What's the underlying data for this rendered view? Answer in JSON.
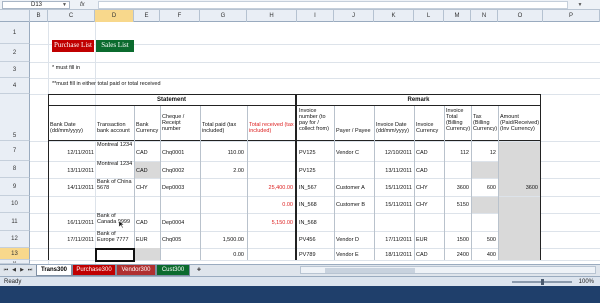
{
  "formula_bar": {
    "name_box": "D13",
    "fx_symbol": "fx",
    "formula": ""
  },
  "columns": [
    "B",
    "C",
    "D",
    "E",
    "F",
    "G",
    "H",
    "I",
    "J",
    "K",
    "L",
    "M",
    "N",
    "O",
    "P"
  ],
  "rows": [
    "1",
    "2",
    "3",
    "4",
    "5",
    "7",
    "8",
    "9",
    "10",
    "11",
    "12",
    "13",
    "14"
  ],
  "buttons": {
    "purchase": "Purchase List",
    "sales": "Sales List"
  },
  "notes": {
    "note1": "* must fill in",
    "note2": "**must fill in either total paid or total received"
  },
  "sections": {
    "statement": "Statement",
    "remark": "Remark"
  },
  "headers": {
    "bank_date": "Bank Date (dd/mm/yyyy)",
    "transaction_bank_account": "Transaction bank account",
    "bank_currency": "Bank Currency",
    "cheque_number": "Cheque / Receipt number",
    "total_paid": "Total paid (tax included)",
    "total_received": "Total received (tax included)",
    "invoice_number": "Invoice number (to pay for / collect from)",
    "payer_payee": "Payer / Payee",
    "invoice_date": "Invoice Date (dd/mm/yyyy)",
    "invoice_currency": "Invoice Currency",
    "invoice_total": "Invoice Total (Billing Currency)",
    "tax": "Tax (Billing Currency)",
    "amount": "Amount (Paid/Received) (Inv Currency)"
  },
  "data_rows": [
    {
      "date": "12/11/2011",
      "account": "Montreal 1234",
      "currency": "CAD",
      "cheque": "Chq0001",
      "paid": "110.00",
      "received": "",
      "invoice": "PV125",
      "payer": "Vendor C",
      "inv_date": "12/10/2011",
      "inv_cur": "CAD",
      "inv_total": "112",
      "tax": "12",
      "amount": ""
    },
    {
      "date": "13/11/2011",
      "account": "Montreal 1234",
      "currency": "CAD",
      "cheque": "Chq0002",
      "paid": "2.00",
      "received": "",
      "invoice": "PV125",
      "payer": "",
      "inv_date": "13/11/2011",
      "inv_cur": "CAD",
      "inv_total": "",
      "tax": "",
      "amount": ""
    },
    {
      "date": "14/11/2011",
      "account": "Bank of China 5678",
      "currency": "CHY",
      "cheque": "Dep0003",
      "paid": "",
      "received": "25,400.00",
      "invoice": "IN_567",
      "payer": "Customer A",
      "inv_date": "15/11/2011",
      "inv_cur": "CHY",
      "inv_total": "3600",
      "tax": "600",
      "amount": "3600"
    },
    {
      "date": "",
      "account": "",
      "currency": "",
      "cheque": "",
      "paid": "",
      "received": "0.00",
      "invoice": "IN_568",
      "payer": "Customer B",
      "inv_date": "15/11/2011",
      "inv_cur": "CHY",
      "inv_total": "5150",
      "tax": "",
      "amount": ""
    },
    {
      "date": "16/11/2011",
      "account": "Bank of Canada 9999",
      "currency": "CAD",
      "cheque": "Dep0004",
      "paid": "",
      "received": "5,150.00",
      "invoice": "IN_568",
      "payer": "",
      "inv_date": "",
      "inv_cur": "",
      "inv_total": "",
      "tax": "",
      "amount": ""
    },
    {
      "date": "17/11/2011",
      "account": "Bank of Europe 7777",
      "currency": "EUR",
      "cheque": "Chq005",
      "paid": "1,500.00",
      "received": "",
      "invoice": "PV456",
      "payer": "Vendor D",
      "inv_date": "17/11/2011",
      "inv_cur": "EUR",
      "inv_total": "1500",
      "tax": "500",
      "amount": ""
    },
    {
      "date": "",
      "account": "",
      "currency": "",
      "cheque": "",
      "paid": "0.00",
      "received": "",
      "invoice": "PV789",
      "payer": "Vendor E",
      "inv_date": "18/11/2011",
      "inv_cur": "CAD",
      "inv_total": "2400",
      "tax": "400",
      "amount": ""
    }
  ],
  "sheet_tabs": [
    {
      "label": "Trans300",
      "active": true,
      "color": "#ffffff"
    },
    {
      "label": "Purchase300",
      "active": false,
      "color": "#c00000"
    },
    {
      "label": "Vendor300",
      "active": false,
      "color": "#b03030"
    },
    {
      "label": "Cust300",
      "active": false,
      "color": "#0b6b2e"
    }
  ],
  "status": {
    "ready": "Ready",
    "zoom": "100%"
  },
  "colors": {
    "selection_header": "#f8d88c",
    "shaded_cell": "#d9d9d9",
    "red_text": "#dd2222"
  }
}
